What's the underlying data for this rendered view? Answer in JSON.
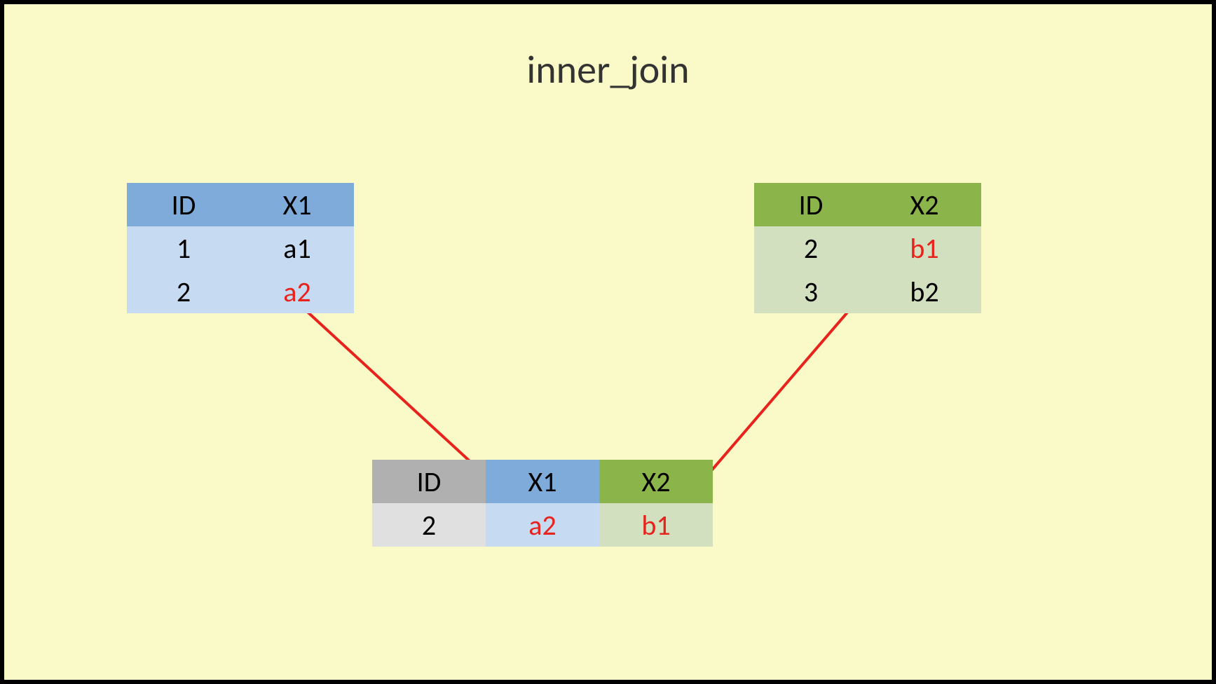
{
  "title": "inner_join",
  "left_table": {
    "headers": [
      "ID",
      "X1"
    ],
    "rows": [
      {
        "id": "1",
        "x": "a1",
        "highlight": false
      },
      {
        "id": "2",
        "x": "a2",
        "highlight": true
      }
    ]
  },
  "right_table": {
    "headers": [
      "ID",
      "X2"
    ],
    "rows": [
      {
        "id": "2",
        "x": "b1",
        "highlight": true
      },
      {
        "id": "3",
        "x": "b2",
        "highlight": false
      }
    ]
  },
  "result_table": {
    "headers": [
      "ID",
      "X1",
      "X2"
    ],
    "rows": [
      {
        "id": "2",
        "x1": "a2",
        "x2": "b1"
      }
    ]
  }
}
